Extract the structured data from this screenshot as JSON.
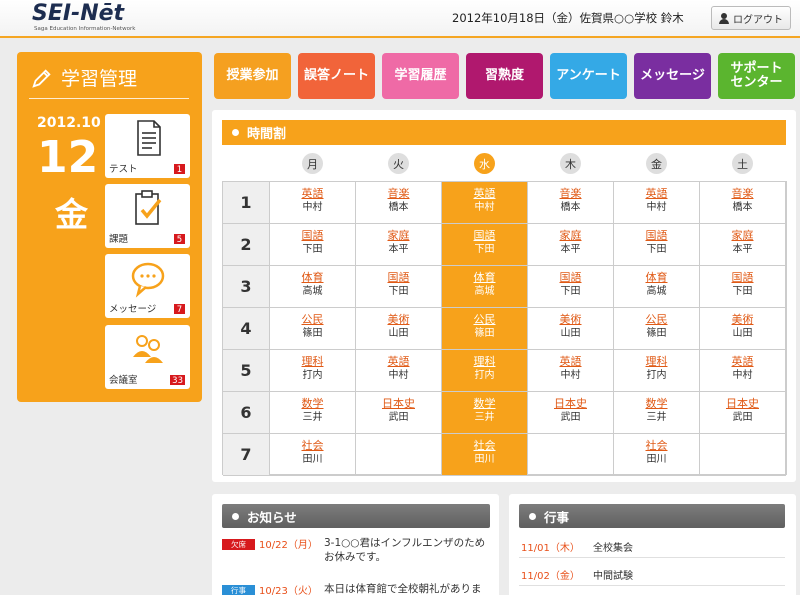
{
  "header": {
    "logo_main": "SEI-Nēt",
    "logo_sub": "Saga Education Information-Network",
    "info": "2012年10月18日（金）佐賀県○○学校  鈴木",
    "logout_label": "ログアウト"
  },
  "left_panel": {
    "title": "学習管理",
    "date_ym": "2012.10",
    "date_day": "12",
    "date_weekday": "金",
    "tiles": [
      {
        "label": "テスト",
        "badge": "1",
        "icon": "document-icon"
      },
      {
        "label": "課題",
        "badge": "5",
        "icon": "clipboard-check-icon"
      },
      {
        "label": "メッセージ",
        "badge": "7",
        "icon": "speech-bubble-icon"
      },
      {
        "label": "会議室",
        "badge": "33",
        "icon": "people-icon"
      }
    ]
  },
  "nav": [
    {
      "label": "授業参加",
      "color": "#f5a020"
    },
    {
      "label": "誤答ノート",
      "color": "#f1643a"
    },
    {
      "label": "学習履歴",
      "color": "#ef6aa6"
    },
    {
      "label": "習熟度",
      "color": "#b0186e"
    },
    {
      "label": "アンケート",
      "color": "#34a9e6"
    },
    {
      "label": "メッセージ",
      "color": "#7a2ea0"
    },
    {
      "label": "サポート\nセンター",
      "color": "#5bb52f"
    }
  ],
  "timetable": {
    "title": "時間割",
    "days": [
      "月",
      "火",
      "水",
      "木",
      "金",
      "土"
    ],
    "today_index": 2,
    "rows": [
      {
        "period": "1",
        "cells": [
          [
            "英語",
            "中村"
          ],
          [
            "音楽",
            "橋本"
          ],
          [
            "英語",
            "中村"
          ],
          [
            "音楽",
            "橋本"
          ],
          [
            "英語",
            "中村"
          ],
          [
            "音楽",
            "橋本"
          ]
        ]
      },
      {
        "period": "2",
        "cells": [
          [
            "国語",
            "下田"
          ],
          [
            "家庭",
            "本平"
          ],
          [
            "国語",
            "下田"
          ],
          [
            "家庭",
            "本平"
          ],
          [
            "国語",
            "下田"
          ],
          [
            "家庭",
            "本平"
          ]
        ]
      },
      {
        "period": "3",
        "cells": [
          [
            "体育",
            "高城"
          ],
          [
            "国語",
            "下田"
          ],
          [
            "体育",
            "高城"
          ],
          [
            "国語",
            "下田"
          ],
          [
            "体育",
            "高城"
          ],
          [
            "国語",
            "下田"
          ]
        ]
      },
      {
        "period": "4",
        "cells": [
          [
            "公民",
            "篠田"
          ],
          [
            "美術",
            "山田"
          ],
          [
            "公民",
            "篠田"
          ],
          [
            "美術",
            "山田"
          ],
          [
            "公民",
            "篠田"
          ],
          [
            "美術",
            "山田"
          ]
        ]
      },
      {
        "period": "5",
        "cells": [
          [
            "理科",
            "打内"
          ],
          [
            "英語",
            "中村"
          ],
          [
            "理科",
            "打内"
          ],
          [
            "英語",
            "中村"
          ],
          [
            "理科",
            "打内"
          ],
          [
            "英語",
            "中村"
          ]
        ]
      },
      {
        "period": "6",
        "cells": [
          [
            "数学",
            "三井"
          ],
          [
            "日本史",
            "武田"
          ],
          [
            "数学",
            "三井"
          ],
          [
            "日本史",
            "武田"
          ],
          [
            "数学",
            "三井"
          ],
          [
            "日本史",
            "武田"
          ]
        ]
      },
      {
        "period": "7",
        "cells": [
          [
            "社会",
            "田川"
          ],
          [
            "",
            ""
          ],
          [
            "社会",
            "田川"
          ],
          [
            "",
            ""
          ],
          [
            "社会",
            "田川"
          ],
          [
            "",
            ""
          ]
        ]
      }
    ]
  },
  "notices": {
    "title": "お知らせ",
    "items": [
      {
        "badge": "欠席",
        "badge_color": "#d7191d",
        "date": "10/22（月）",
        "text": "3-1○○君はインフルエンザのためお休みです。"
      },
      {
        "badge": "行事",
        "badge_color": "#2a8fd6",
        "date": "10/23（火）",
        "text": "本日は体育館で全校朝礼がありま"
      }
    ]
  },
  "events": {
    "title": "行事",
    "items": [
      {
        "date": "11/01（木）",
        "name": "全校集会"
      },
      {
        "date": "11/02（金）",
        "name": "中間試験"
      }
    ]
  }
}
